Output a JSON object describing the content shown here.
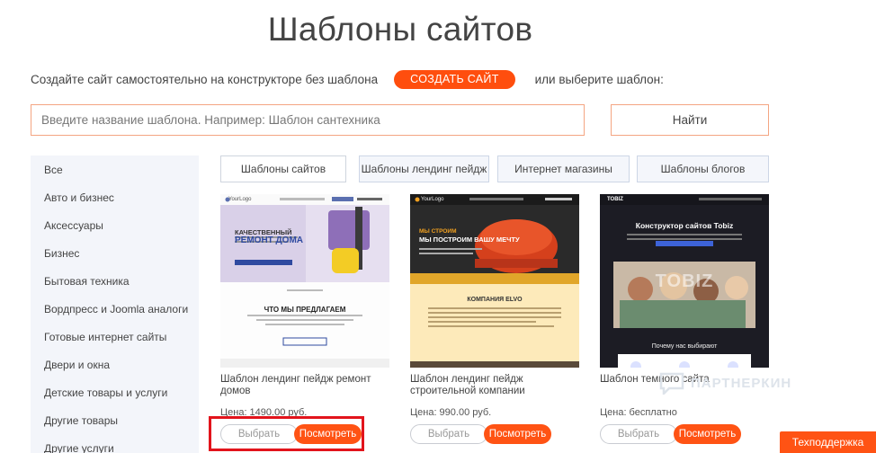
{
  "page": {
    "title": "Шаблоны сайтов"
  },
  "intro": {
    "text": "Создайте сайт самостоятельно на конструкторе без шаблона",
    "create_button": "СОЗДАТЬ САЙТ",
    "or_text": "или выберите шаблон:"
  },
  "search": {
    "placeholder": "Введите название шаблона. Например: Шаблон сантехника",
    "button": "Найти"
  },
  "sidebar": {
    "items": [
      {
        "label": "Все"
      },
      {
        "label": "Авто и бизнес"
      },
      {
        "label": "Аксессуары"
      },
      {
        "label": "Бизнес"
      },
      {
        "label": "Бытовая техника"
      },
      {
        "label": "Вордпресс и Joomla аналоги"
      },
      {
        "label": "Готовые интернет сайты"
      },
      {
        "label": "Двери и окна"
      },
      {
        "label": "Детские товары и услуги"
      },
      {
        "label": "Другие товары"
      },
      {
        "label": "Другие услуги"
      }
    ]
  },
  "tabs": [
    {
      "label": "Шаблоны сайтов",
      "active": true
    },
    {
      "label": "Шаблоны лендинг пейдж",
      "active": false
    },
    {
      "label": "Интернет магазины",
      "active": false
    },
    {
      "label": "Шаблоны блогов",
      "active": false
    }
  ],
  "cards": [
    {
      "title": "Шаблон лендинг пейдж ремонт домов",
      "price": "Цена: 1490.00 руб.",
      "choose": "Выбрать",
      "view": "Посмотреть",
      "thumb": {
        "logo": "YourLogo",
        "headline_small": "КАЧЕСТВЕННЫЙ",
        "headline_big": "РЕМОНТ ДОМА",
        "section": "ЧТО МЫ ПРЕДЛАГАЕМ"
      }
    },
    {
      "title": "Шаблон лендинг пейдж строительной компании",
      "price": "Цена: 990.00 руб.",
      "choose": "Выбрать",
      "view": "Посмотреть",
      "thumb": {
        "logo": "YourLogo",
        "headline_small": "МЫ СТРОИМ",
        "headline_big": "МЫ ПОСТРОИМ ВАШУ МЕЧТУ",
        "section": "КОМПАНИЯ ELVO"
      }
    },
    {
      "title": "Шаблон темного сайта",
      "price": "Цена: бесплатно",
      "choose": "Выбрать",
      "view": "Посмотреть",
      "thumb": {
        "logo": "TOBIZ",
        "headline_big": "Конструктор сайтов Tobiz",
        "overlay": "TOBIZ",
        "section": "Почему нас выбирают"
      }
    }
  ],
  "watermark": "ПАРТНЕРКИН",
  "support_button": "Техподдержка",
  "colors": {
    "accent": "#ff5314",
    "input_border": "#f4a582",
    "sidebar_bg": "#f3f5fa",
    "highlight": "#e2141c"
  }
}
